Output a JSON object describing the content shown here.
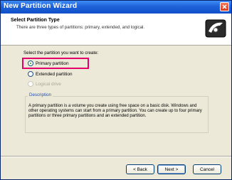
{
  "window": {
    "title": "New Partition Wizard"
  },
  "header": {
    "title": "Select Partition Type",
    "subtitle": "There are three types of partitions: primary, extended, and logical."
  },
  "instruction": "Select the partition you want to create:",
  "options": [
    {
      "label": "Primary partition",
      "checked": true,
      "disabled": false
    },
    {
      "label": "Extended partition",
      "checked": false,
      "disabled": false
    },
    {
      "label": "Logical drive",
      "checked": false,
      "disabled": true
    }
  ],
  "description": {
    "legend": "Description",
    "text": "A primary partition is a volume you create using free space on a basic disk. Windows and other operating systems can start from a primary partition. You can create up to four primary partitions or three primary partitions and an extended partition."
  },
  "buttons": {
    "back": "< Back",
    "next": "Next >",
    "cancel": "Cancel"
  },
  "colors": {
    "highlight": "#e3006a",
    "titlebar": "#1f62d8"
  }
}
